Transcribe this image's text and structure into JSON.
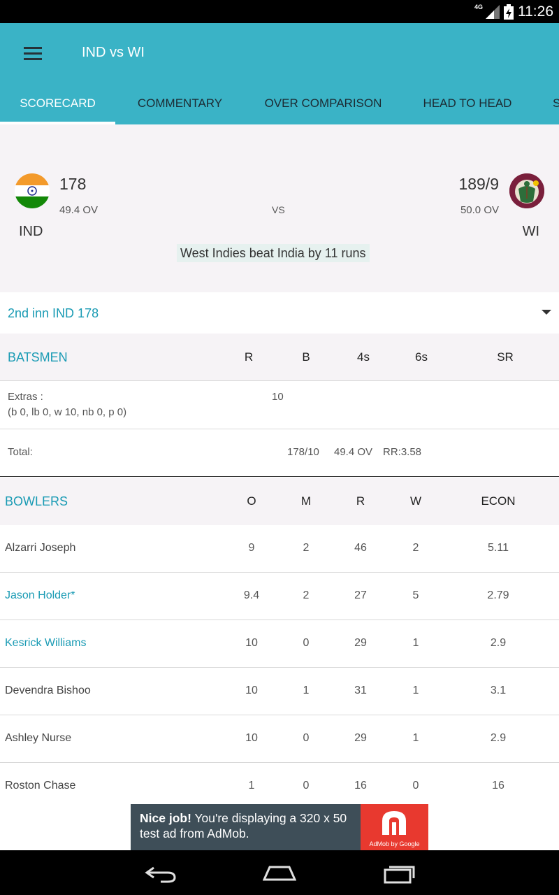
{
  "status_bar": {
    "network": "4G",
    "time": "11:26"
  },
  "app_bar": {
    "title": "IND vs WI"
  },
  "tabs": [
    {
      "label": "SCORECARD",
      "active": true
    },
    {
      "label": "COMMENTARY",
      "active": false
    },
    {
      "label": "OVER COMPARISON",
      "active": false
    },
    {
      "label": "HEAD TO HEAD",
      "active": false
    },
    {
      "label": "S",
      "active": false
    }
  ],
  "match": {
    "team1": {
      "name": "IND",
      "score": "178",
      "overs": "49.4 OV"
    },
    "team2": {
      "name": "WI",
      "score": "189/9",
      "overs": "50.0 OV"
    },
    "vs_label": "VS",
    "result": "West Indies beat India by 11 runs"
  },
  "innings": {
    "label": "2nd inn IND 178"
  },
  "batsmen_header": {
    "title": "BATSMEN",
    "columns": [
      "R",
      "B",
      "4s",
      "6s",
      "SR"
    ]
  },
  "extras": {
    "label": "Extras :",
    "detail": "(b 0, lb 0, w 10, nb 0, p 0)",
    "value": "10"
  },
  "total": {
    "label": "Total:",
    "score": "178/10",
    "overs": "49.4 OV",
    "run_rate": "RR:3.58"
  },
  "bowlers_header": {
    "title": "BOWLERS",
    "columns": [
      "O",
      "M",
      "R",
      "W",
      "ECON"
    ]
  },
  "bowlers": [
    {
      "name": "Alzarri Joseph",
      "o": "9",
      "m": "2",
      "r": "46",
      "w": "2",
      "econ": "5.11",
      "highlight": false
    },
    {
      "name": "Jason Holder*",
      "o": "9.4",
      "m": "2",
      "r": "27",
      "w": "5",
      "econ": "2.79",
      "highlight": true
    },
    {
      "name": "Kesrick Williams",
      "o": "10",
      "m": "0",
      "r": "29",
      "w": "1",
      "econ": "2.9",
      "highlight": true
    },
    {
      "name": "Devendra Bishoo",
      "o": "10",
      "m": "1",
      "r": "31",
      "w": "1",
      "econ": "3.1",
      "highlight": false
    },
    {
      "name": "Ashley Nurse",
      "o": "10",
      "m": "0",
      "r": "29",
      "w": "1",
      "econ": "2.9",
      "highlight": false
    },
    {
      "name": "Roston Chase",
      "o": "1",
      "m": "0",
      "r": "16",
      "w": "0",
      "econ": "16",
      "highlight": false
    }
  ],
  "ad": {
    "headline": "Nice job!",
    "body": " You're displaying a 320 x 50 test ad from AdMob.",
    "logo_caption": "AdMob by Google"
  },
  "colors": {
    "primary": "#3ab3c6",
    "accent_text": "#1a9bb4",
    "ad_red": "#e8392f"
  }
}
